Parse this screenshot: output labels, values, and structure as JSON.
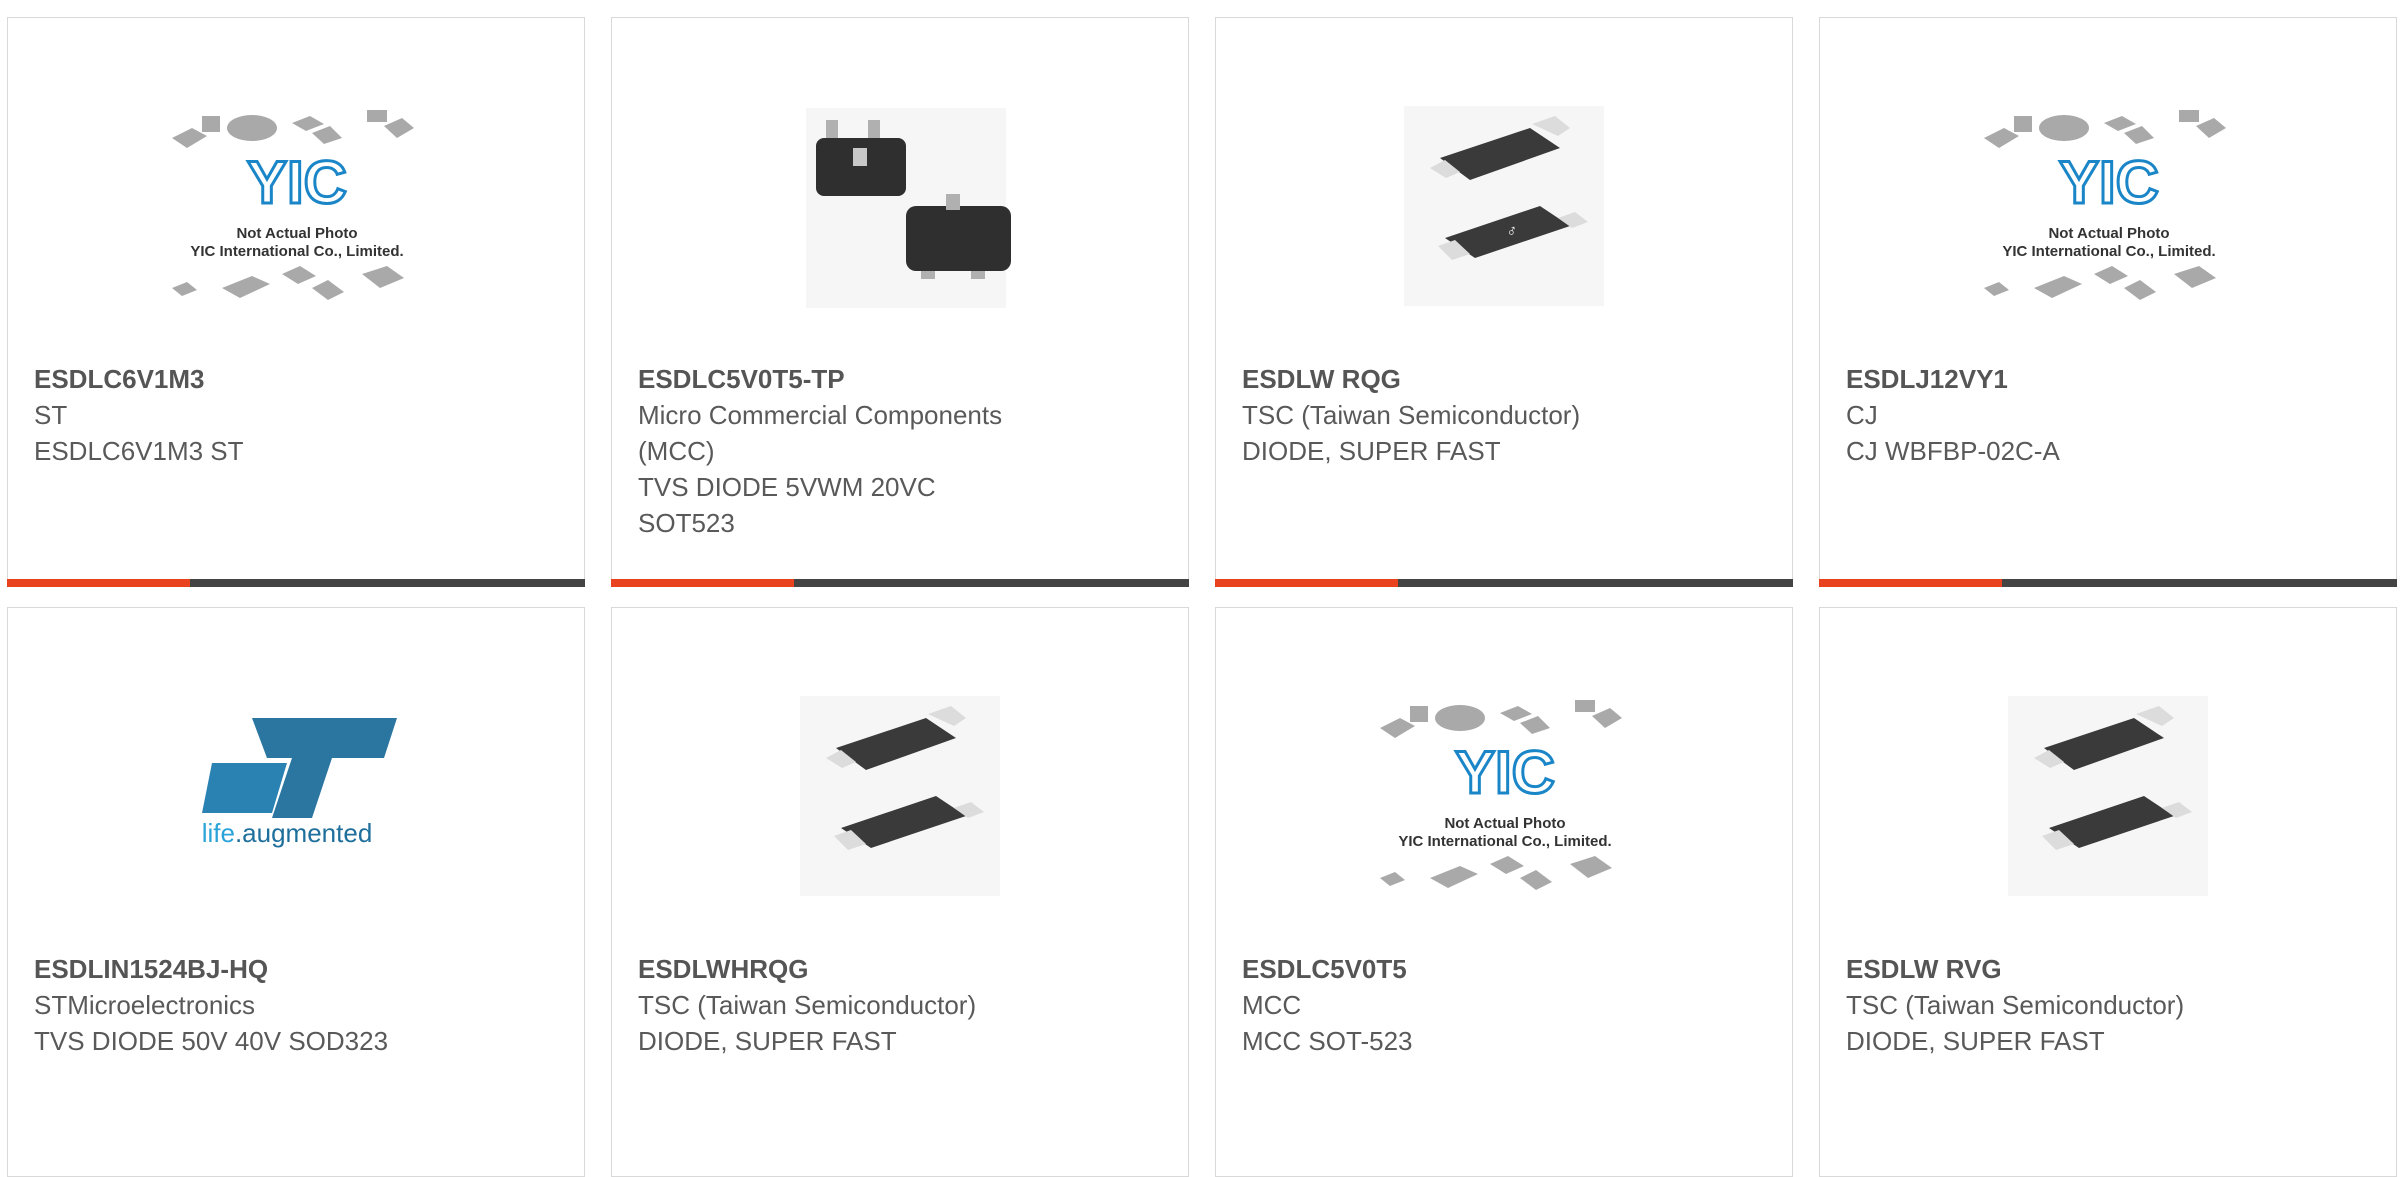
{
  "products": [
    {
      "part": "ESDLC6V1M3",
      "maker": "ST",
      "desc": "ESDLC6V1M3 ST",
      "image": "yic-placeholder"
    },
    {
      "part": "ESDLC5V0T5-TP",
      "maker": "Micro Commercial Components (MCC)",
      "desc": "TVS DIODE 5VWM 20VC SOT523",
      "image": "sot523-package-photo"
    },
    {
      "part": "ESDLW RQG",
      "maker": "TSC (Taiwan Semiconductor)",
      "desc": "DIODE, SUPER FAST",
      "image": "smd-diode-photo"
    },
    {
      "part": "ESDLJ12VY1",
      "maker": "CJ",
      "desc": "CJ WBFBP-02C-A",
      "image": "yic-placeholder"
    },
    {
      "part": "ESDLIN1524BJ-HQ",
      "maker": "STMicroelectronics",
      "desc": "TVS DIODE 50V 40V SOD323",
      "image": "st-logo"
    },
    {
      "part": "ESDLWHRQG",
      "maker": "TSC (Taiwan Semiconductor)",
      "desc": "DIODE, SUPER FAST",
      "image": "smd-diode-photo"
    },
    {
      "part": "ESDLC5V0T5",
      "maker": "MCC",
      "desc": "MCC SOT-523",
      "image": "yic-placeholder"
    },
    {
      "part": "ESDLW RVG",
      "maker": "TSC (Taiwan Semiconductor)",
      "desc": "DIODE, SUPER FAST",
      "image": "smd-diode-photo"
    }
  ],
  "placeholder": {
    "logo_text": "YIC",
    "line1": "Not Actual Photo",
    "line2": "YIC International Co., Limited."
  },
  "st_logo": {
    "mark": "ST",
    "tagline_life": "life",
    "tagline_rest": ".augmented"
  },
  "colors": {
    "accent": "#e8421f",
    "bar": "#444444",
    "text": "#595959",
    "logo_blue": "#1a86c8",
    "st_blue": "#1f6f9c"
  }
}
